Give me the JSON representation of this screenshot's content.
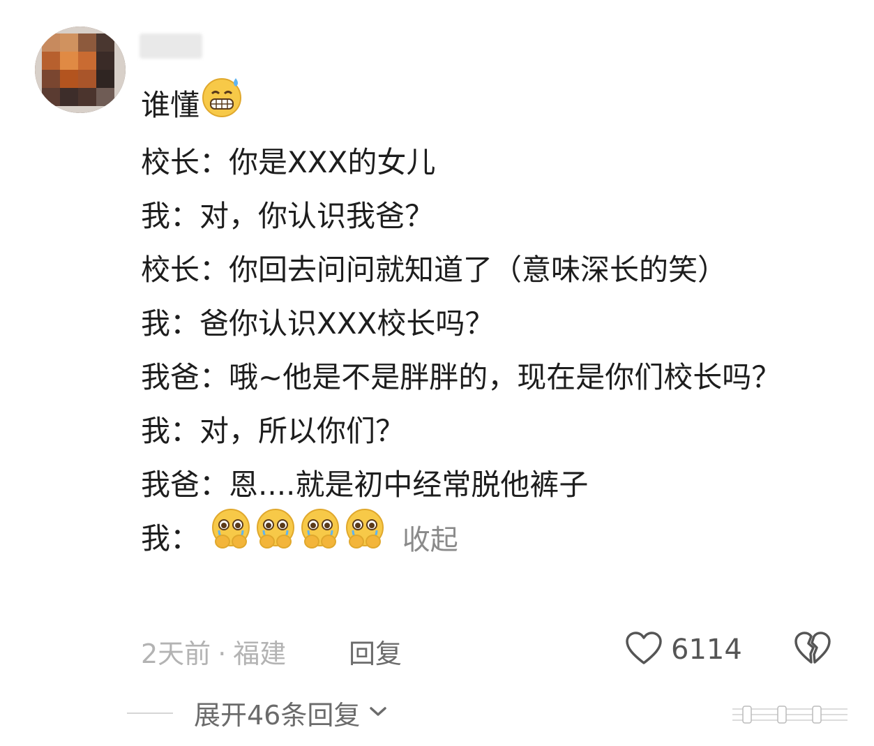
{
  "comment": {
    "first_line": "谁懂",
    "lines": [
      "校长：你是XXX的女儿",
      "我：对，你认识我爸？",
      "校长：你回去问问就知道了（意味深长的笑）",
      "我：爸你认识XXX校长吗？",
      "我爸：哦~他是不是胖胖的，现在是你们校长吗？",
      "我：对，所以你们？",
      "我爸：恩....就是初中经常脱他裤子"
    ],
    "last_line_prefix": "我：",
    "collapse_label": "收起",
    "emojis": [
      "grimace-sweat-emoji",
      "crying-hands-emoji",
      "crying-hands-emoji",
      "crying-hands-emoji",
      "crying-hands-emoji"
    ]
  },
  "meta": {
    "time": "2天前",
    "separator": "·",
    "location": "福建",
    "reply_label": "回复",
    "like_count": "6114",
    "like_icon": "heart-outline-icon",
    "dislike_icon": "broken-heart-icon"
  },
  "expand": {
    "label": "展开46条回复",
    "icon": "chevron-down-icon"
  },
  "colors": {
    "text": "#1d1d1d",
    "muted": "#b3b3b3",
    "secondary": "#6b6b6b",
    "emoji_face": "#f7c948"
  }
}
